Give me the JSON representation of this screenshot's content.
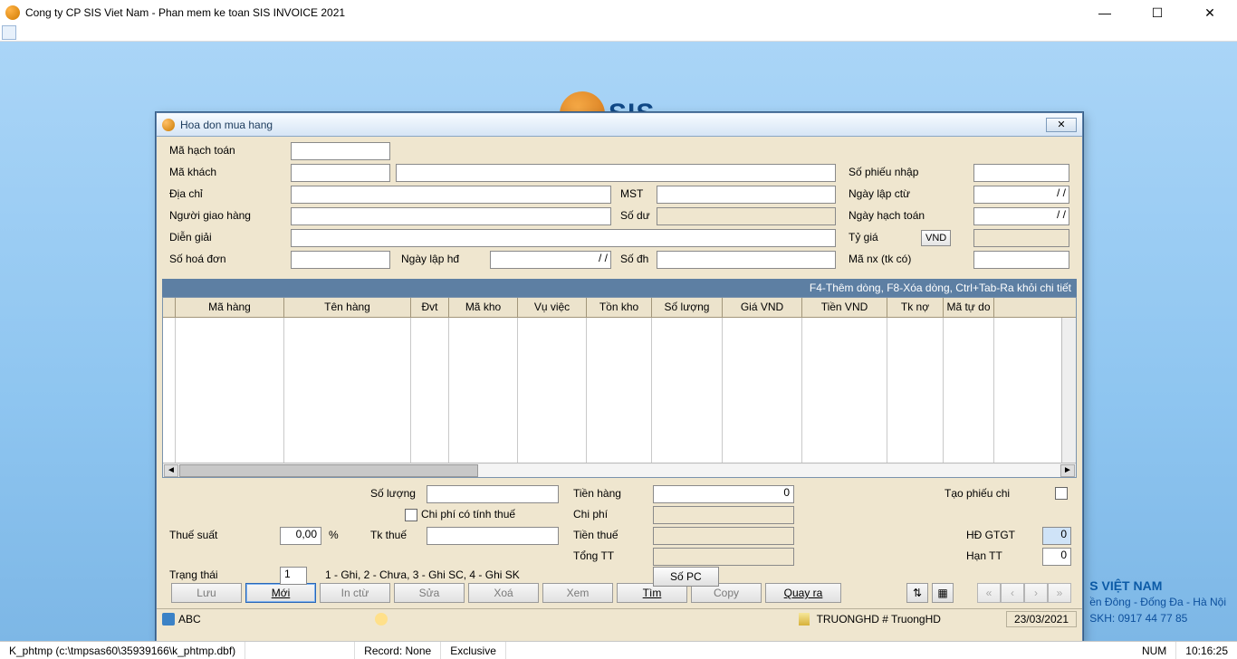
{
  "app": {
    "title": "Cong ty CP SIS Viet Nam - Phan mem ke toan SIS INVOICE 2021"
  },
  "background": {
    "company_heading": "S VIỆT NAM",
    "address_line": "ền Đông - Đống Đa - Hà Nội",
    "hotline_line": "SKH: 0917 44 77 85"
  },
  "dialog": {
    "title": "Hoa don mua hang",
    "labels": {
      "ma_hach_toan": "Mã hạch toán",
      "ma_khach": "Mã khách",
      "dia_chi": "Địa chỉ",
      "mst": "MST",
      "nguoi_giao_hang": "Người giao hàng",
      "so_du": "Số dư",
      "dien_giai": "Diễn giải",
      "so_hoa_don": "Số hoá đơn",
      "ngay_lap_hd": "Ngày lập hđ",
      "so_dh": "Số đh",
      "so_phieu_nhap": "Số phiếu nhập",
      "ngay_lap_ctu": "Ngày lập ctừ",
      "ngay_hach_toan": "Ngày hạch toán",
      "ty_gia": "Tỷ giá",
      "ma_nx": "Mã nx (tk có)"
    },
    "values": {
      "ma_hach_toan": "",
      "ma_khach": "",
      "ten_khach": "",
      "dia_chi": "",
      "mst": "",
      "nguoi_giao_hang": "",
      "so_du": "",
      "dien_giai": "",
      "so_hoa_don": "",
      "ngay_lap_hd": "/  /",
      "so_dh": "",
      "so_phieu_nhap": "",
      "ngay_lap_ctu": "/  /",
      "ngay_hach_toan": "/  /",
      "ty_gia_ccy": "VND",
      "ty_gia": "",
      "ma_nx": ""
    },
    "grid": {
      "hint": "F4-Thêm dòng, F8-Xóa dòng, Ctrl+Tab-Ra khỏi chi tiết",
      "columns": [
        "Mã hàng",
        "Tên hàng",
        "Đvt",
        "Mã kho",
        "Vụ việc",
        "Tồn kho",
        "Số lượng",
        "Giá VND",
        "Tiền VND",
        "Tk nợ",
        "Mã tự do"
      ],
      "widths": [
        120,
        140,
        42,
        76,
        76,
        72,
        78,
        88,
        94,
        62,
        56
      ]
    },
    "summary": {
      "labels": {
        "so_luong": "Số lượng",
        "chi_phi_thue": "Chi phí có tính thuế",
        "thue_suat": "Thuế suất",
        "tk_thue": "Tk thuế",
        "tien_hang": "Tiền hàng",
        "chi_phi": "Chi phí",
        "tien_thue": "Tiền thuế",
        "tong_tt": "Tổng TT",
        "tao_phieu_chi": "Tạo phiếu chi",
        "hd_gtgt": "HĐ GTGT",
        "han_tt": "Hạn TT",
        "trang_thai": "Trạng thái",
        "trang_thai_note": "1 - Ghi, 2 - Chưa, 3 - Ghi SC, 4 - Ghi SK",
        "so_pc_btn": "Số PC",
        "pct": "%"
      },
      "values": {
        "so_luong": "",
        "thue_suat": "0,00",
        "tk_thue": "",
        "tien_hang": "0",
        "chi_phi": "",
        "tien_thue": "",
        "tong_tt": "",
        "hd_gtgt": "0",
        "han_tt": "0",
        "trang_thai": "1"
      }
    },
    "buttons": {
      "luu": "Lưu",
      "moi": "Mới",
      "in_ctu": "In ctừ",
      "sua": "Sửa",
      "xoa": "Xoá",
      "xem": "Xem",
      "tim": "Tìm",
      "copy": "Copy",
      "quay_ra": "Quay ra"
    },
    "status": {
      "abc": "ABC",
      "user": "TRUONGHD # TruongHD",
      "date": "23/03/2021"
    }
  },
  "app_status": {
    "left": "K_phtmp (c:\\tmpsas60\\35939166\\k_phtmp.dbf)",
    "record": "Record: None",
    "mode": "Exclusive",
    "num": "NUM",
    "time": "10:16:25"
  }
}
